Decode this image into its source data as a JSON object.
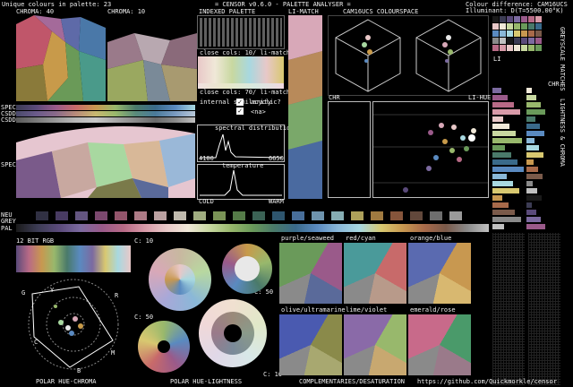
{
  "header": {
    "unique_colours": "Unique colours in palette: 23",
    "app_title": "= CENSOR v0.6.0 - PALETTE ANALYSER =",
    "colour_difference": "Colour difference: CAM16UCS",
    "illuminant": "Illuminant: D(T=5500.00°K)"
  },
  "sections": {
    "chroma40": "CHROMA: 40",
    "chroma10": "CHROMA: 10",
    "indexed_palette": "INDEXED PALETTE",
    "li_match": "LI-MATCH",
    "cam16ucs": "CAM16UCS COLOURSPACE",
    "chr_left": "CHR",
    "li_hue": "LI-HUE",
    "li_label": "LI",
    "chr_right": "CHR",
    "vertical_a": "GREYSCALE MATCHES",
    "vertical_b": "LIGHTNESS & CHROMA",
    "spec": "SPEC",
    "cvd": "CSDD",
    "csdd": "CSDD",
    "spec_bg": "SPEC BGS",
    "neu": "NEU",
    "grey": "GREY",
    "pal": "PAL",
    "rgb12": "12 BIT RGB",
    "c10a": "C: 10",
    "c50a": "C: 50",
    "c50b": "C: 50",
    "c10b": "C: 10"
  },
  "indexed": {
    "close_cols_1": "close cols: 10/ li-match",
    "close_cols_2": "close cols: 70/ li-match",
    "internal_similarity": "internal similarity",
    "cyclic": "acyclic?",
    "na": "<na>",
    "spectral_distribution": "spectral distribution",
    "spec_min": "4100",
    "spec_max": "6650",
    "temperature": "temperature",
    "cold": "COLD",
    "warm": "WARM"
  },
  "polar_labels": {
    "g": "G",
    "y": "Y",
    "r": "R",
    "c": "C",
    "b": "B",
    "m": "M"
  },
  "complementary_titles": [
    "purple/seaweed",
    "red/cyan",
    "orange/blue",
    "olive/ultramarine",
    "lime/violet",
    "emerald/rose"
  ],
  "footer": {
    "polar_hue_chroma": "POLAR HUE-CHROMA",
    "polar_hue_lightness": "POLAR HUE-LIGHTNESS",
    "complementaries": "COMPLEMENTARIES/DESATURATION",
    "url": "https://github.com/Quickmorkle/censor"
  },
  "palette": [
    "#1a1a1a",
    "#3c3c54",
    "#5a4a7a",
    "#7c6aa0",
    "#9a5a8a",
    "#b86a86",
    "#d89aa8",
    "#e8c8c8",
    "#f0e8d8",
    "#c8d8a0",
    "#98b86c",
    "#6a9a5a",
    "#4a7a6a",
    "#3a6a8a",
    "#5a8ac0",
    "#8ab8d8",
    "#a8d8e0",
    "#d8c870",
    "#c89850",
    "#a86a4a",
    "#7a5a4a",
    "#8a8a8a",
    "#c0c0c0"
  ],
  "colors": {
    "background": "#000000",
    "text": "#f0f0f0",
    "border": "#bbbbbb"
  }
}
